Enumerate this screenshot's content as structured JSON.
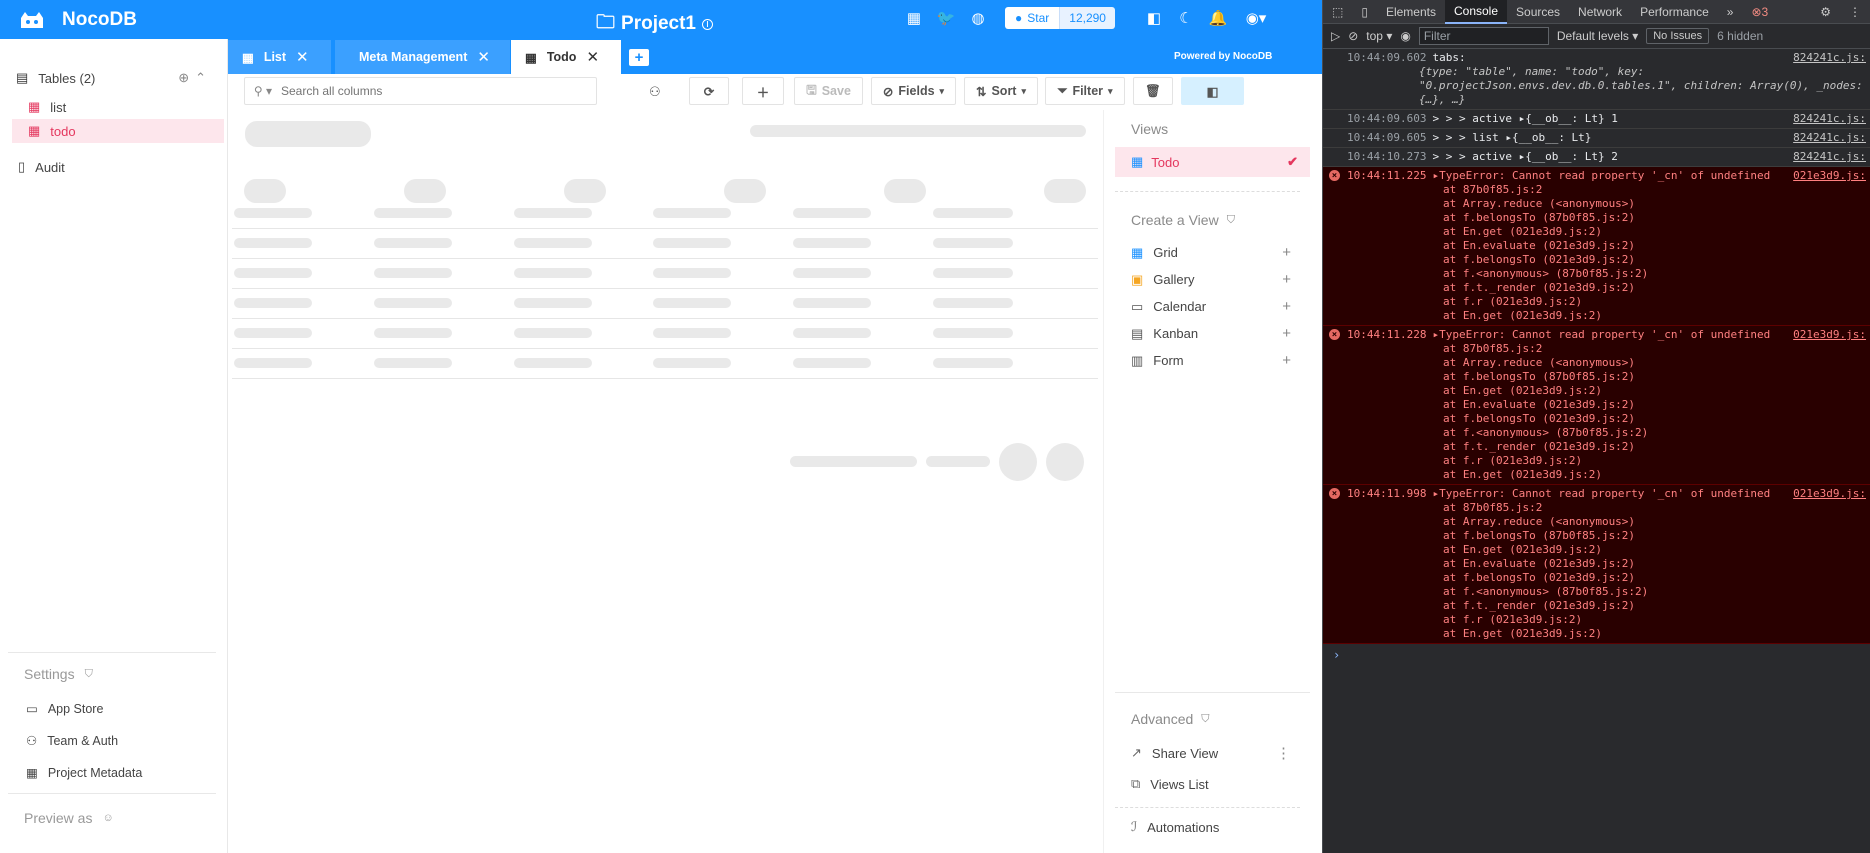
{
  "app": {
    "brand": "NocoDB",
    "project": "Project1",
    "github": {
      "star_label": "Star",
      "count": "12,290"
    },
    "colors": {
      "primary": "#1890ff",
      "accent_pink": "#e4375e"
    }
  },
  "sidebar": {
    "tables_label": "Tables (2)",
    "tables": [
      {
        "label": "list"
      },
      {
        "label": "todo"
      }
    ],
    "audit": "Audit",
    "settings_label": "Settings",
    "links": [
      {
        "label": "App Store"
      },
      {
        "label": "Team & Auth"
      },
      {
        "label": "Project Metadata"
      }
    ],
    "preview_label": "Preview as"
  },
  "tabs": [
    {
      "label": "List"
    },
    {
      "label": "Meta Management"
    },
    {
      "label": "Todo"
    }
  ],
  "powered_by": "Powered by NocoDB",
  "toolbar": {
    "search_placeholder": "Search all columns",
    "save": "Save",
    "fields": "Fields",
    "sort": "Sort",
    "filter": "Filter"
  },
  "views_panel": {
    "views_label": "Views",
    "active_view": "Todo",
    "create_label": "Create a View",
    "create_items": [
      {
        "label": "Grid",
        "color": "#1890ff"
      },
      {
        "label": "Gallery",
        "color": "#f5a623"
      },
      {
        "label": "Calendar",
        "color": "#555555"
      },
      {
        "label": "Kanban",
        "color": "#555555"
      },
      {
        "label": "Form",
        "color": "#555555"
      }
    ],
    "advanced_label": "Advanced",
    "share_view": "Share View",
    "views_list": "Views List",
    "automations": "Automations"
  },
  "devtools": {
    "tabs": [
      "Elements",
      "Console",
      "Sources",
      "Network",
      "Performance"
    ],
    "error_count": "3",
    "context": "top",
    "filter_placeholder": "Filter",
    "levels": "Default levels",
    "issues": "No Issues",
    "hidden": "6 hidden",
    "logs": [
      {
        "time": "10:44:09.602",
        "text": "tabs:",
        "src": "824241c.js:",
        "sub": "{type: \"table\", name: \"todo\", key: \"0.projectJson.envs.dev.db.0.tables.1\", children: Array(0), _nodes: {…}, …}"
      },
      {
        "time": "10:44:09.603",
        "text": "> > > active ▸{__ob__: Lt} 1",
        "src": "824241c.js:"
      },
      {
        "time": "10:44:09.605",
        "text": "> > > list ▸{__ob__: Lt}",
        "src": "824241c.js:"
      },
      {
        "time": "10:44:10.273",
        "text": "> > > active ▸{__ob__: Lt} 2",
        "src": "824241c.js:"
      }
    ],
    "errors": [
      {
        "time": "10:44:11.225",
        "msg": "▸TypeError: Cannot read property '_cn' of undefined",
        "src": "021e3d9.js:"
      },
      {
        "time": "10:44:11.228",
        "msg": "▸TypeError: Cannot read property '_cn' of undefined",
        "src": "021e3d9.js:"
      },
      {
        "time": "10:44:11.998",
        "msg": "▸TypeError: Cannot read property '_cn' of undefined",
        "src": "021e3d9.js:"
      }
    ],
    "stack": [
      "at 87b0f85.js:2",
      "at Array.reduce (<anonymous>)",
      "at f.belongsTo (87b0f85.js:2)",
      "at En.get (021e3d9.js:2)",
      "at En.evaluate (021e3d9.js:2)",
      "at f.belongsTo (021e3d9.js:2)",
      "at f.<anonymous> (87b0f85.js:2)",
      "at f.t._render (021e3d9.js:2)",
      "at f.r (021e3d9.js:2)",
      "at En.get (021e3d9.js:2)"
    ]
  }
}
